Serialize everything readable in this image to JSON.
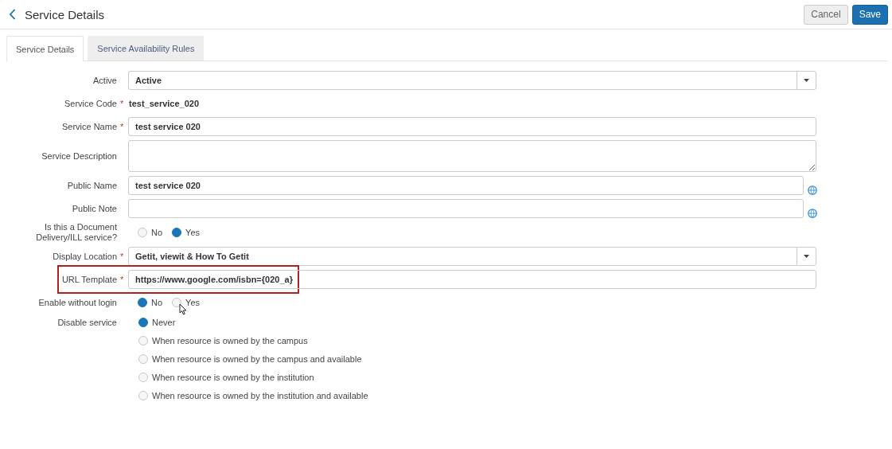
{
  "header": {
    "title": "Service Details",
    "buttons": [
      {
        "label": "Cancel",
        "kind": "secondary"
      },
      {
        "label": "Save",
        "kind": "primary"
      }
    ]
  },
  "tabs": [
    {
      "label": "Service Details",
      "selected": true
    },
    {
      "label": "Service Availability Rules",
      "selected": false
    }
  ],
  "fields": [
    {
      "kind": "select",
      "label": "Active",
      "value": "Active"
    },
    {
      "kind": "static",
      "label": "Service Code",
      "required_mark": "*",
      "value": "test_service_020"
    },
    {
      "kind": "input",
      "label": "Service Name",
      "required_mark": "*",
      "value": "test service 020"
    },
    {
      "kind": "textarea",
      "label": "Service Description"
    },
    {
      "kind": "input",
      "label": "Public Name",
      "value": "test service 020",
      "translatable": true
    },
    {
      "kind": "input",
      "label": "Public Note",
      "translatable": true
    },
    {
      "kind": "radio",
      "label": "Is this a Document Delivery/ILL service?",
      "options": [
        {
          "label": "No",
          "selected": false
        },
        {
          "label": "Yes",
          "selected": true
        }
      ]
    },
    {
      "kind": "select",
      "label": "Display Location",
      "required_mark": "*",
      "value": "Getit, viewit & How To Getit"
    },
    {
      "kind": "input",
      "label": "URL Template",
      "required_mark": "*",
      "value": "https://www.google.com/isbn={020_a}",
      "highlighted": true
    },
    {
      "kind": "radio",
      "label": "Enable without login",
      "options": [
        {
          "label": "No",
          "selected": true
        },
        {
          "label": "Yes",
          "selected": false,
          "hovered": true
        }
      ]
    },
    {
      "kind": "radio_list",
      "label": "Disable service",
      "options": [
        {
          "label": "Never",
          "selected": true
        },
        {
          "label": "When resource is owned by the campus",
          "selected": false
        },
        {
          "label": "When resource is owned by the campus and available",
          "selected": false
        },
        {
          "label": "When resource is owned by the institution",
          "selected": false
        },
        {
          "label": "When resource is owned by the institution and available",
          "selected": false
        }
      ]
    }
  ]
}
